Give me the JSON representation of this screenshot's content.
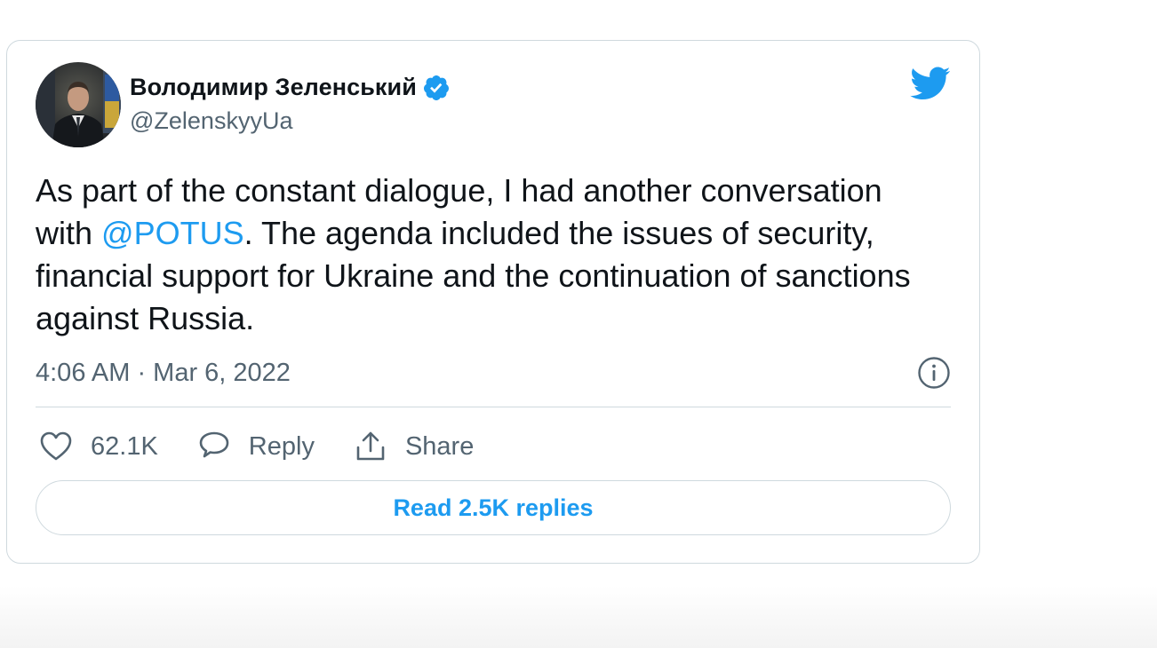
{
  "tweet": {
    "author": {
      "display_name": "Володимир Зеленський",
      "handle": "@ZelenskyyUa",
      "verified": true,
      "avatar_icon": "profile-photo"
    },
    "text_segments": {
      "before_mention": "As part of the constant dialogue, I had another conversation with ",
      "mention": "@POTUS",
      "after_mention": ". The agenda included the issues of security, financial support for Ukraine and the continuation of sanctions against Russia."
    },
    "timestamp": "4:06 AM · Mar 6, 2022",
    "actions": {
      "like_count": "62.1K",
      "reply_label": "Reply",
      "share_label": "Share"
    },
    "read_replies_label": "Read 2.5K replies"
  },
  "icons": {
    "brand": "twitter-bird-icon",
    "verified": "verified-badge-icon",
    "info": "info-icon",
    "like": "heart-icon",
    "reply": "reply-bubble-icon",
    "share": "share-icon"
  },
  "colors": {
    "accent": "#1d9bf0",
    "text_primary": "#0f1419",
    "text_secondary": "#536471",
    "border": "#cfd9de"
  }
}
